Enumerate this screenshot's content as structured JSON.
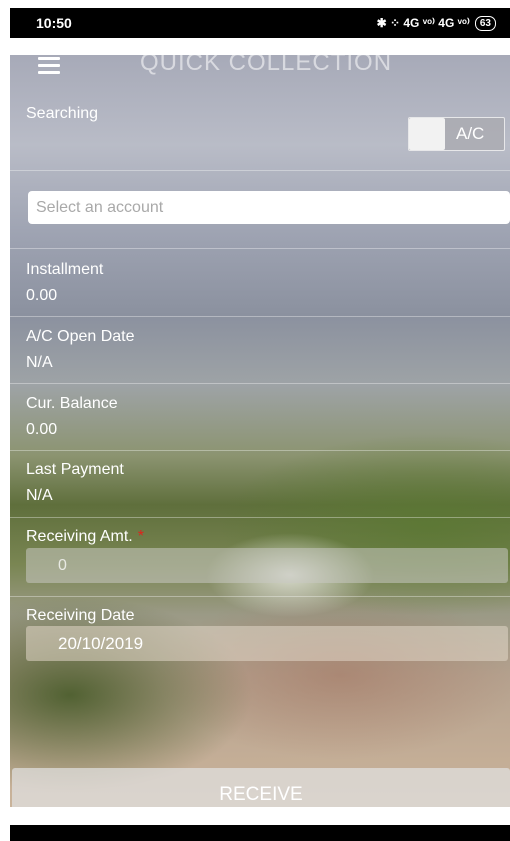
{
  "status_bar": {
    "time": "10:50",
    "network": "✱ ⁘ 4G ᵛᵒ⁾ 4G ᵛᵒ⁾",
    "battery": "63"
  },
  "header": {
    "title": "QUICK COLLECTION",
    "menu_icon": "hamburger-icon"
  },
  "search": {
    "label": "Searching",
    "toggle_label": "A/C"
  },
  "account_select": {
    "placeholder": "Select an account"
  },
  "fields": [
    {
      "label": "Installment",
      "value": "0.00"
    },
    {
      "label": "A/C Open Date",
      "value": "N/A"
    },
    {
      "label": "Cur. Balance",
      "value": "0.00"
    },
    {
      "label": "Last Payment",
      "value": "N/A"
    }
  ],
  "receiving_amount": {
    "label": "Receiving Amt.",
    "required_mark": "*",
    "placeholder": "0"
  },
  "receiving_date": {
    "label": "Receiving Date",
    "value": "20/10/2019"
  },
  "receive_button": {
    "label": "RECEIVE"
  },
  "colors": {
    "required": "#e0231c",
    "status_bar": "#000000"
  }
}
